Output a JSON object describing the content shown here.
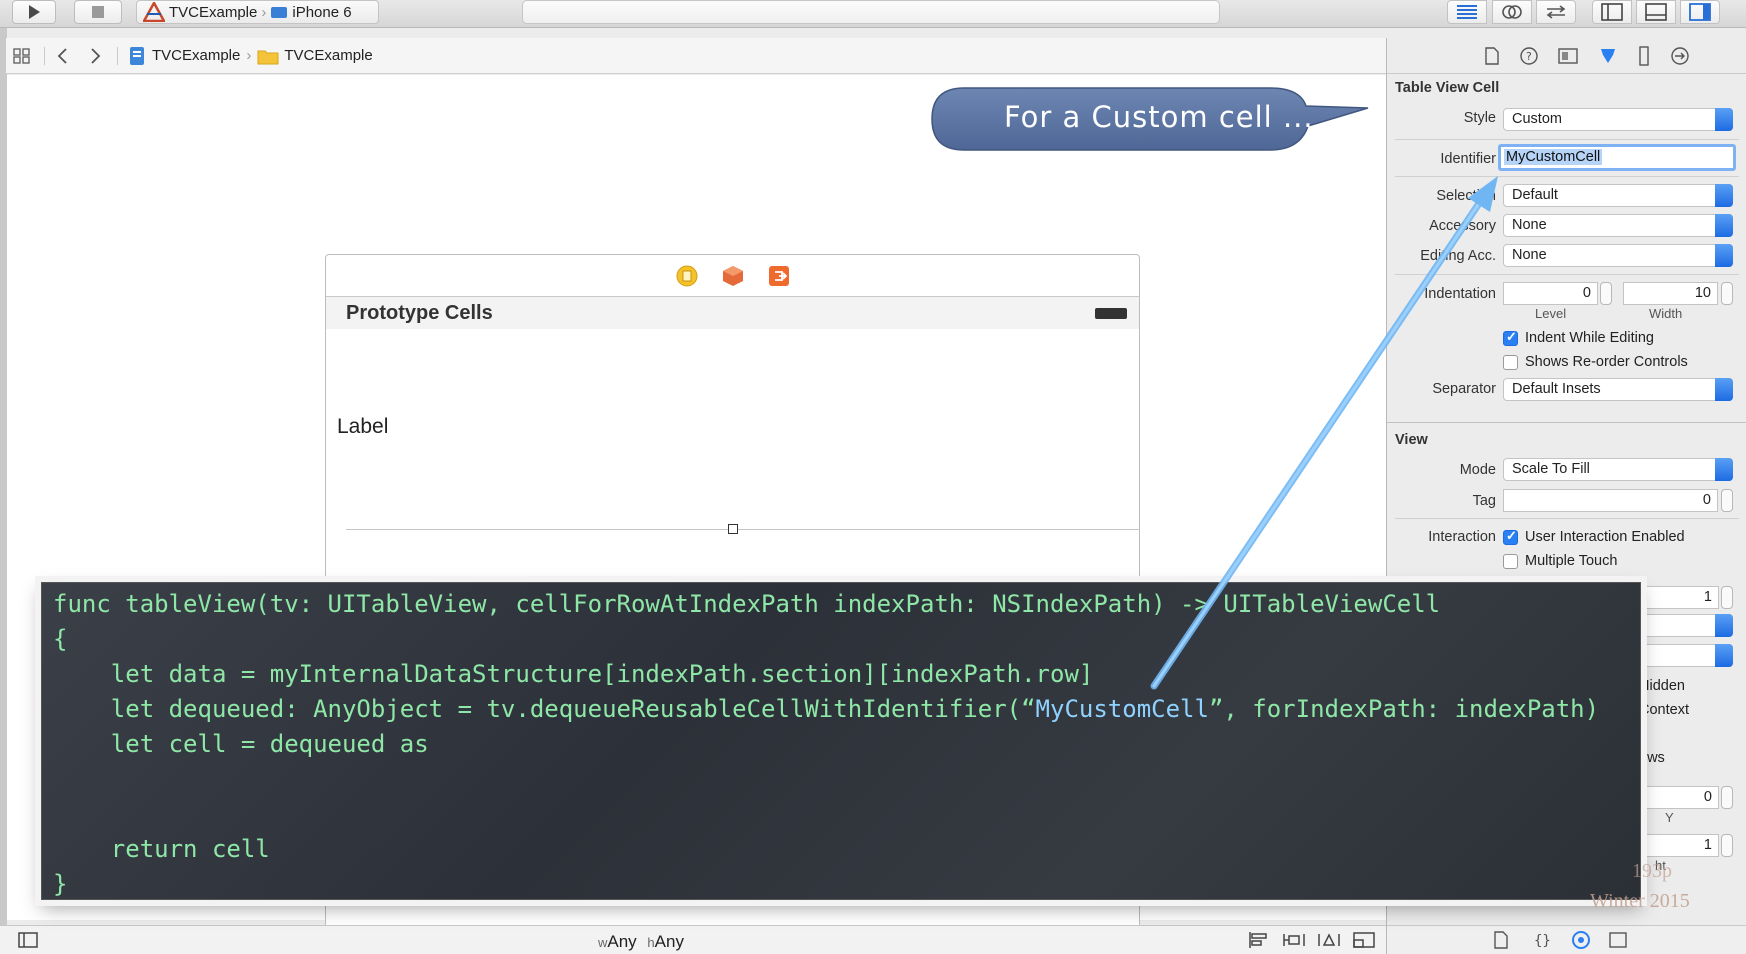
{
  "toolbar": {
    "scheme_target": "TVCExample",
    "scheme_device": "iPhone 6"
  },
  "jumpbar": {
    "crumbs": [
      "TVCExample",
      "TVCExample"
    ]
  },
  "callout": {
    "text": "For a Custom cell ..."
  },
  "scene": {
    "prototype_header": "Prototype Cells",
    "cell_label": "Label"
  },
  "bottombar": {
    "size_w_prefix": "w",
    "size_w": "Any",
    "size_h_prefix": "h",
    "size_h": "Any"
  },
  "inspector": {
    "section_table_view_cell": "Table View Cell",
    "style_label": "Style",
    "style_value": "Custom",
    "identifier_label": "Identifier",
    "identifier_value": "MyCustomCell",
    "selection_label": "Selection",
    "selection_value": "Default",
    "accessory_label": "Accessory",
    "accessory_value": "None",
    "editing_label": "Editing Acc.",
    "editing_value": "None",
    "indentation_label": "Indentation",
    "indent_level_value": "0",
    "indent_width_value": "10",
    "level_label": "Level",
    "width_label": "Width",
    "indent_while_editing": "Indent While Editing",
    "shows_reorder": "Shows Re-order Controls",
    "separator_label": "Separator",
    "separator_value": "Default Insets",
    "section_view": "View",
    "mode_label": "Mode",
    "mode_value": "Scale To Fill",
    "tag_label": "Tag",
    "tag_value": "0",
    "interaction_label": "Interaction",
    "user_interaction": "User Interaction Enabled",
    "multiple_touch": "Multiple Touch",
    "partial_value_1": "1",
    "partial_hidden": "Hidden",
    "partial_context": "Context",
    "partial_views": "ews",
    "partial_value_0": "0",
    "partial_y": "Y",
    "partial_value_1b": "1",
    "partial_height": "ht"
  },
  "code": {
    "line1": "func tableView(tv: UITableView, cellForRowAtIndexPath indexPath: NSIndexPath) -> UITableViewCell",
    "line2": "{",
    "line3": "    let data = myInternalDataStructure[indexPath.section][indexPath.row]",
    "line4_pre": "    let dequeued: AnyObject = tv.dequeueReusableCellWithIdentifier(“",
    "line4_str": "MyCustomCell",
    "line4_post": "”, forIndexPath: indexPath)",
    "line5": "    let cell = dequeued as",
    "line6": "    return cell",
    "line7": "}"
  },
  "watermark": {
    "course": "193p",
    "term": "Winter 2015"
  }
}
